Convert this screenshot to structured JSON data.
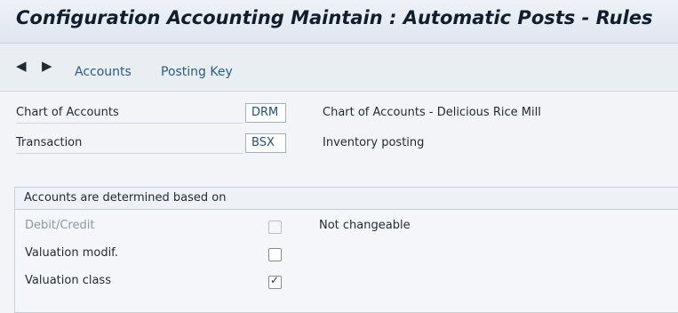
{
  "window": {
    "title": "Configuration Accounting Maintain : Automatic Posts - Rules"
  },
  "toolbar": {
    "back_icon": "triangle-left-icon",
    "forward_icon": "triangle-right-icon",
    "accounts_label": "Accounts",
    "posting_key_label": "Posting Key"
  },
  "fields": {
    "chart_of_accounts": {
      "label": "Chart of Accounts",
      "value": "DRM",
      "description": "Chart of Accounts - Delicious Rice Mill"
    },
    "transaction": {
      "label": "Transaction",
      "value": "BSX",
      "description": "Inventory posting"
    }
  },
  "group": {
    "title": "Accounts are determined based on",
    "items": [
      {
        "label": "Debit/Credit",
        "checked": false,
        "enabled": false,
        "note": "Not changeable"
      },
      {
        "label": "Valuation modif.",
        "checked": false,
        "enabled": true,
        "note": ""
      },
      {
        "label": "Valuation class",
        "checked": true,
        "enabled": true,
        "note": ""
      }
    ]
  },
  "icons": {
    "checkmark": "✓"
  }
}
